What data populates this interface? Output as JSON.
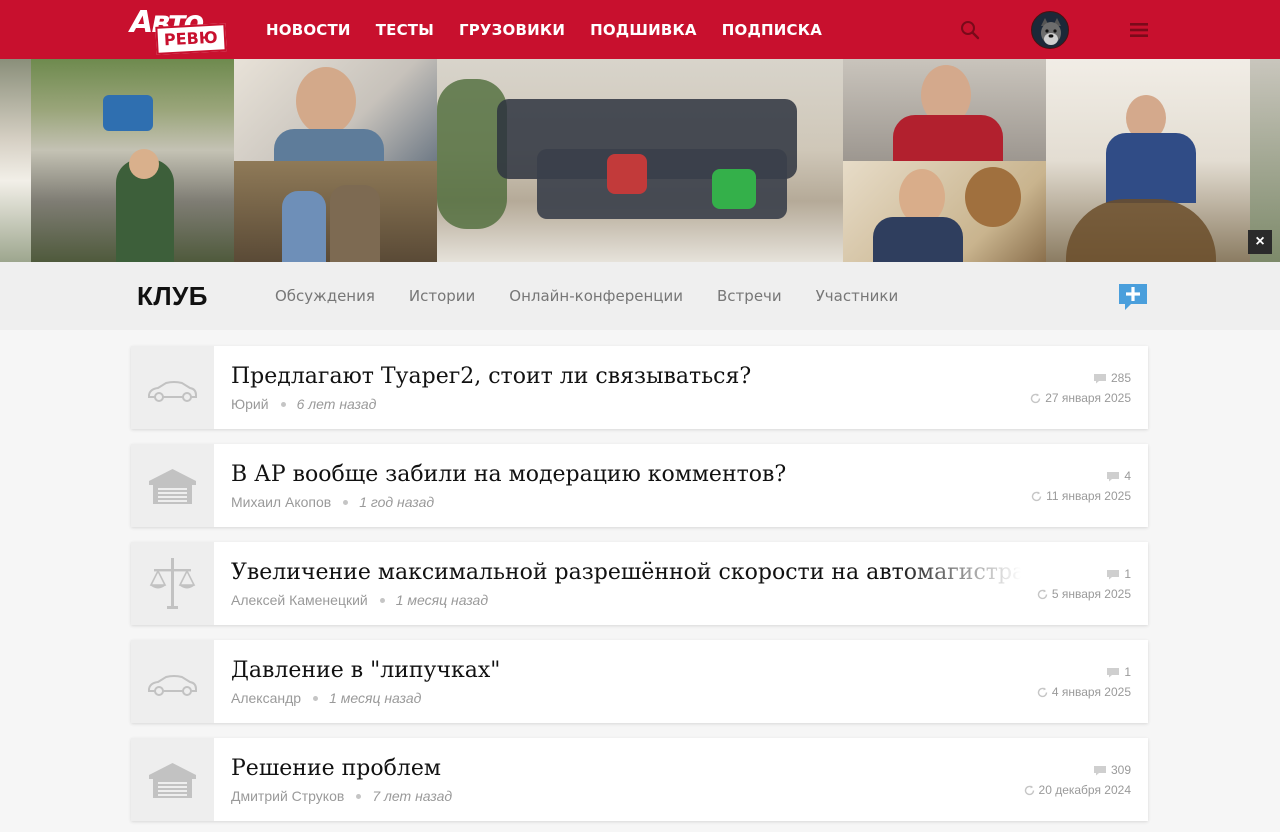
{
  "header": {
    "logo_top": "Авто",
    "logo_bottom": "РЕВЮ",
    "nav": [
      "НОВОСТИ",
      "ТЕСТЫ",
      "ГРУЗОВИКИ",
      "ПОДШИВКА",
      "ПОДПИСКА"
    ],
    "icons": [
      "search-icon",
      "avatar",
      "menu-icon"
    ]
  },
  "banner": {
    "close_label": "×"
  },
  "club": {
    "title": "КЛУБ",
    "tabs": [
      "Обсуждения",
      "Истории",
      "Онлайн-конференции",
      "Встречи",
      "Участники"
    ],
    "add_icon": "add-discussion-icon"
  },
  "topics": [
    {
      "title": "Предлагают Туарег2, стоит ли связываться?",
      "author": "Юрий",
      "ago": "6 лет назад",
      "comments": "285",
      "date": "27 января 2025",
      "icon": "car-icon"
    },
    {
      "title": "В АР вообще забили на модерацию комментов?",
      "author": "Михаил Акопов",
      "ago": "1 год назад",
      "comments": "4",
      "date": "11 января 2025",
      "icon": "garage-icon"
    },
    {
      "title": "Увеличение максимальной разрешённой скорости на автомагистралях",
      "author": "Алексей Каменецкий",
      "ago": "1 месяц назад",
      "comments": "1",
      "date": "5 января 2025",
      "icon": "law-scales-icon"
    },
    {
      "title": "Давление в \"липучках\"",
      "author": "Александр",
      "ago": "1 месяц назад",
      "comments": "1",
      "date": "4 января 2025",
      "icon": "car-icon"
    },
    {
      "title": "Решение проблем",
      "author": "Дмитрий Струков",
      "ago": "7 лет назад",
      "comments": "309",
      "date": "20 декабря 2024",
      "icon": "garage-icon"
    }
  ],
  "colors": {
    "brand_red": "#c8102e",
    "accent_blue": "#4a9fdc"
  }
}
